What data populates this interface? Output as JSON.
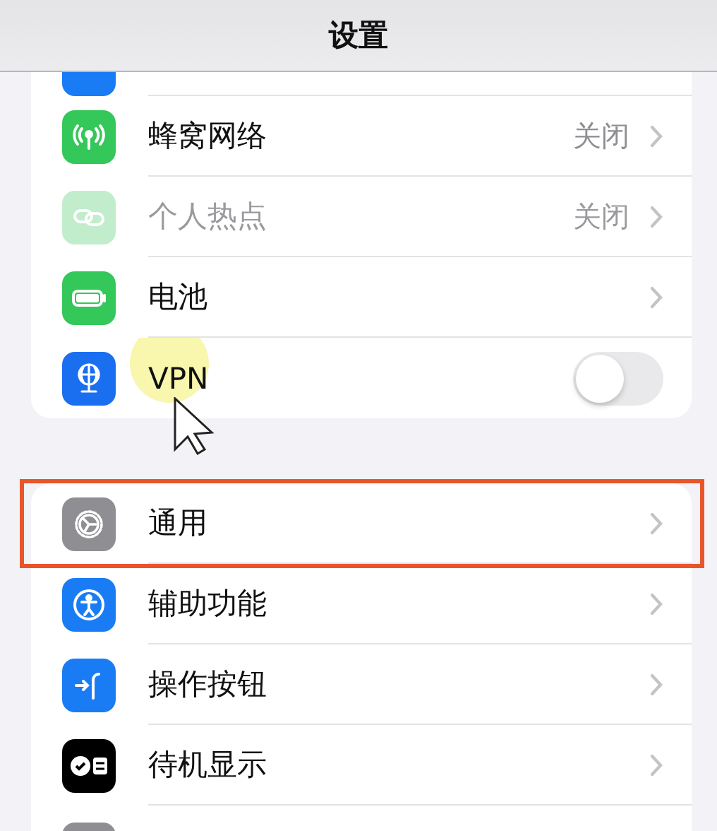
{
  "title": "设置",
  "groups": [
    {
      "rows": [
        {
          "kind": "clipped"
        },
        {
          "kind": "link",
          "label": "蜂窝网络",
          "value": "关闭",
          "disabled": false,
          "highlighted": false
        },
        {
          "kind": "link",
          "label": "个人热点",
          "value": "关闭",
          "disabled": true,
          "highlighted": false
        },
        {
          "kind": "link",
          "label": "电池",
          "disabled": false,
          "highlighted": false
        },
        {
          "kind": "toggle",
          "label": "VPN",
          "on": false,
          "disabled": false,
          "highlighted": false
        }
      ]
    },
    {
      "rows": [
        {
          "kind": "link",
          "label": "通用",
          "disabled": false,
          "highlighted": true
        },
        {
          "kind": "link",
          "label": "辅助功能",
          "disabled": false,
          "highlighted": false
        },
        {
          "kind": "link",
          "label": "操作按钮",
          "disabled": false,
          "highlighted": false
        },
        {
          "kind": "link",
          "label": "待机显示",
          "disabled": false,
          "highlighted": false
        },
        {
          "kind": "clipped_bottom"
        }
      ]
    }
  ]
}
